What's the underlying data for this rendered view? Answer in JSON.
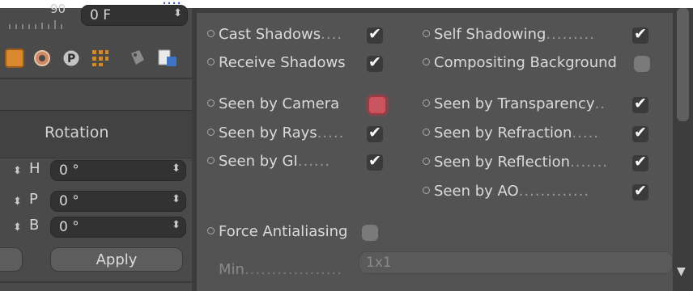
{
  "top_strip": {
    "text": "...."
  },
  "left": {
    "frame": {
      "top_value": "90",
      "value": "0 F"
    },
    "toolbar_icons": [
      "object-icon",
      "gear-icon",
      "p-icon",
      "grid-icon",
      "tag-icon",
      "file-icon"
    ],
    "rotation": {
      "label": "Rotation",
      "fields": [
        {
          "axis": "H",
          "value": "0 °"
        },
        {
          "axis": "P",
          "value": "0 °"
        },
        {
          "axis": "B",
          "value": "0 °"
        }
      ]
    },
    "apply_label": "Apply"
  },
  "right": {
    "cast_shadows": {
      "label": "Cast Shadows",
      "dots": "....",
      "checked": true
    },
    "receive_shadows": {
      "label": "Receive Shadows",
      "dots": "",
      "checked": true
    },
    "seen_by_camera": {
      "label": "Seen by Camera",
      "dots": "",
      "state": "red"
    },
    "seen_by_rays": {
      "label": "Seen by Rays",
      "dots": ".....",
      "checked": true
    },
    "seen_by_gi": {
      "label": "Seen by GI",
      "dots": "......",
      "checked": true
    },
    "self_shadowing": {
      "label": "Self Shadowing",
      "dots": ".........",
      "checked": true
    },
    "compositing_background": {
      "label": "Compositing Background",
      "dots": "",
      "checked": false
    },
    "seen_by_transparency": {
      "label": "Seen by Transparency",
      "dots": "..",
      "checked": true
    },
    "seen_by_refraction": {
      "label": "Seen by Refraction",
      "dots": ".....",
      "checked": true
    },
    "seen_by_reflection": {
      "label": "Seen by Reflection",
      "dots": ".......",
      "checked": true
    },
    "seen_by_ao": {
      "label": "Seen by AO",
      "dots": ".............",
      "checked": true
    },
    "force_antialiasing": {
      "label": "Force Antialiasing",
      "checked": false
    },
    "min": {
      "label": "Min",
      "dots": "..................",
      "value": "1x1"
    }
  }
}
